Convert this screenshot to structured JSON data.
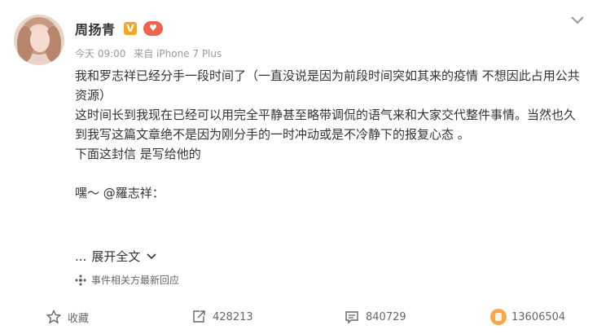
{
  "user": {
    "name": "周扬青",
    "verified_mark": "V",
    "level_badge": "🍓"
  },
  "meta": {
    "time": "今天 09:00",
    "source": "来自 iPhone 7 Plus"
  },
  "post": {
    "lines": [
      "我和罗志祥已经分手一段时间了（一直没说是因为前段时间突如其来的疫情 不想因此占用公共资源）",
      "这时间长到我现在已经可以用完全平静甚至略带调侃的语气来和大家交代整件事情。当然也久到我写这篇文章绝不是因为刚分手的一时冲动或是不冷静下的报复心态 。",
      "下面这封信 是写给他的"
    ],
    "greeting_prefix": "嘿～ ",
    "mention": "@羅志祥",
    "greeting_suffix": "：",
    "ellipsis": "...",
    "expand_label": "展开全文"
  },
  "topic": {
    "label": "事件相关方最新回应"
  },
  "actions": {
    "favorite": "收藏",
    "repost": "428213",
    "comment": "840729",
    "like": "13606504"
  },
  "colors": {
    "text": "#333333",
    "meta": "#999999",
    "verified": "#f5a623",
    "like": "#f6a74a"
  }
}
